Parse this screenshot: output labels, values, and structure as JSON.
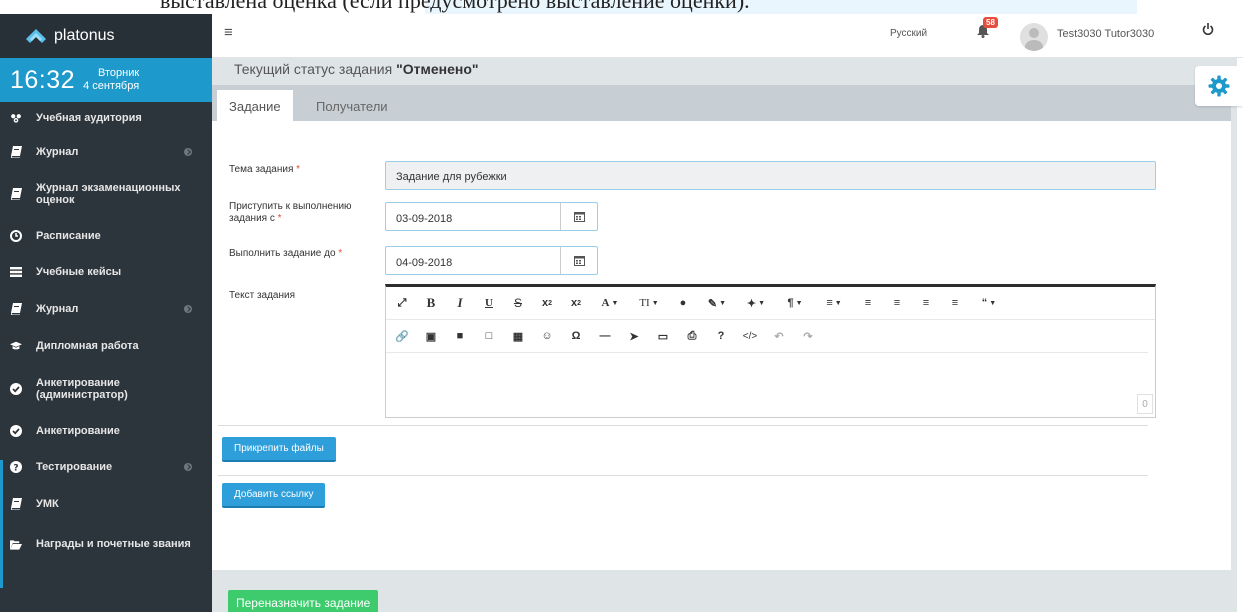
{
  "doc_text": "выставлена оценка (если предусмотрено выставление оценки).",
  "app": {
    "logo_text": "platonus"
  },
  "clock": {
    "time": "16:32",
    "weekday": "Вторник",
    "date": "4 сентября"
  },
  "sidebar": {
    "items": [
      {
        "label": "Учебная аудитория",
        "icon": "group-icon",
        "has_arrow": false
      },
      {
        "label": "Журнал",
        "icon": "book-icon",
        "has_arrow": true
      },
      {
        "label": "Журнал экзаменационных оценок",
        "icon": "book-icon",
        "has_arrow": false
      },
      {
        "label": "Расписание",
        "icon": "clock-icon",
        "has_arrow": false
      },
      {
        "label": "Учебные кейсы",
        "icon": "list-icon",
        "has_arrow": false
      },
      {
        "label": "Журнал",
        "icon": "book-icon",
        "has_arrow": true
      },
      {
        "label": "Дипломная работа",
        "icon": "graduation-cap-icon",
        "has_arrow": false
      },
      {
        "label": "Анкетирование (администратор)",
        "icon": "check-circle-icon",
        "has_arrow": false
      },
      {
        "label": "Анкетирование",
        "icon": "check-circle-icon",
        "has_arrow": false
      },
      {
        "label": "Тестирование",
        "icon": "question-circle-icon",
        "has_arrow": true
      },
      {
        "label": "УМК",
        "icon": "book-icon",
        "has_arrow": false
      },
      {
        "label": "Награды и почетные звания",
        "icon": "folder-open-icon",
        "has_arrow": false
      }
    ]
  },
  "header": {
    "language": "Русский",
    "notification_count": "58",
    "user_name": "Test3030 Tutor3030"
  },
  "status": {
    "prefix": "Текущий статус задания ",
    "value": "\"Отменено\""
  },
  "tabs": [
    {
      "label": "Задание"
    },
    {
      "label": "Получатели"
    }
  ],
  "form": {
    "topic_label": "Тема задания",
    "topic_value": "Задание для рубежки",
    "start_label": "Приступить к выполнению задания с",
    "start_value": "03-09-2018",
    "due_label": "Выполнить задание до",
    "due_value": "04-09-2018",
    "text_label": "Текст задания",
    "required_mark": "*",
    "char_counter": "0"
  },
  "buttons": {
    "attach_files": "Прикрепить файлы",
    "add_link": "Добавить ссылку",
    "reassign": "Переназначить задание"
  },
  "colors": {
    "sidebar_bg": "#2d353c",
    "accent_blue": "#1d99cc",
    "button_blue": "#2e9fdb",
    "button_green": "#3dcb6d",
    "badge_red": "#e74c3c"
  }
}
